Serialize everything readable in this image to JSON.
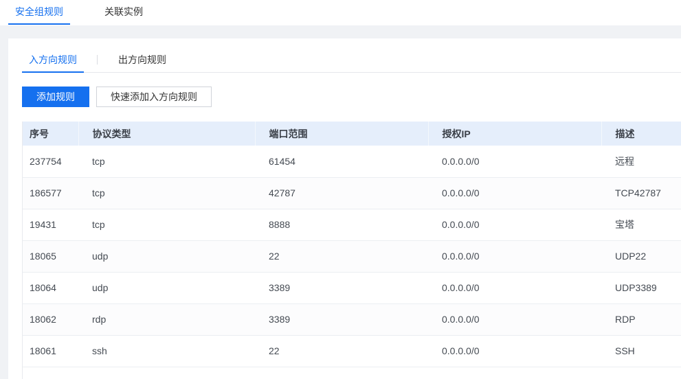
{
  "top_tabs": [
    {
      "label": "安全组规则",
      "active": true
    },
    {
      "label": "关联实例",
      "active": false
    }
  ],
  "sub_tabs": [
    {
      "label": "入方向规则",
      "active": true
    },
    {
      "label": "出方向规则",
      "active": false
    }
  ],
  "toolbar": {
    "add_rule_label": "添加规则",
    "quick_add_label": "快速添加入方向规则"
  },
  "table": {
    "columns": [
      "序号",
      "协议类型",
      "端口范围",
      "授权IP",
      "描述"
    ],
    "rows": [
      {
        "id": "237754",
        "protocol": "tcp",
        "port_range": "61454",
        "authorized_ip": "0.0.0.0/0",
        "description": "远程"
      },
      {
        "id": "186577",
        "protocol": "tcp",
        "port_range": "42787",
        "authorized_ip": "0.0.0.0/0",
        "description": "TCP42787"
      },
      {
        "id": "19431",
        "protocol": "tcp",
        "port_range": "8888",
        "authorized_ip": "0.0.0.0/0",
        "description": "宝塔"
      },
      {
        "id": "18065",
        "protocol": "udp",
        "port_range": "22",
        "authorized_ip": "0.0.0.0/0",
        "description": "UDP22"
      },
      {
        "id": "18064",
        "protocol": "udp",
        "port_range": "3389",
        "authorized_ip": "0.0.0.0/0",
        "description": "UDP3389"
      },
      {
        "id": "18062",
        "protocol": "rdp",
        "port_range": "3389",
        "authorized_ip": "0.0.0.0/0",
        "description": "RDP"
      },
      {
        "id": "18061",
        "protocol": "ssh",
        "port_range": "22",
        "authorized_ip": "0.0.0.0/0",
        "description": "SSH"
      }
    ]
  },
  "colors": {
    "accent": "#1570ef",
    "header_bg": "#e5eefb",
    "page_bg": "#f0f2f5",
    "text": "#333333"
  }
}
